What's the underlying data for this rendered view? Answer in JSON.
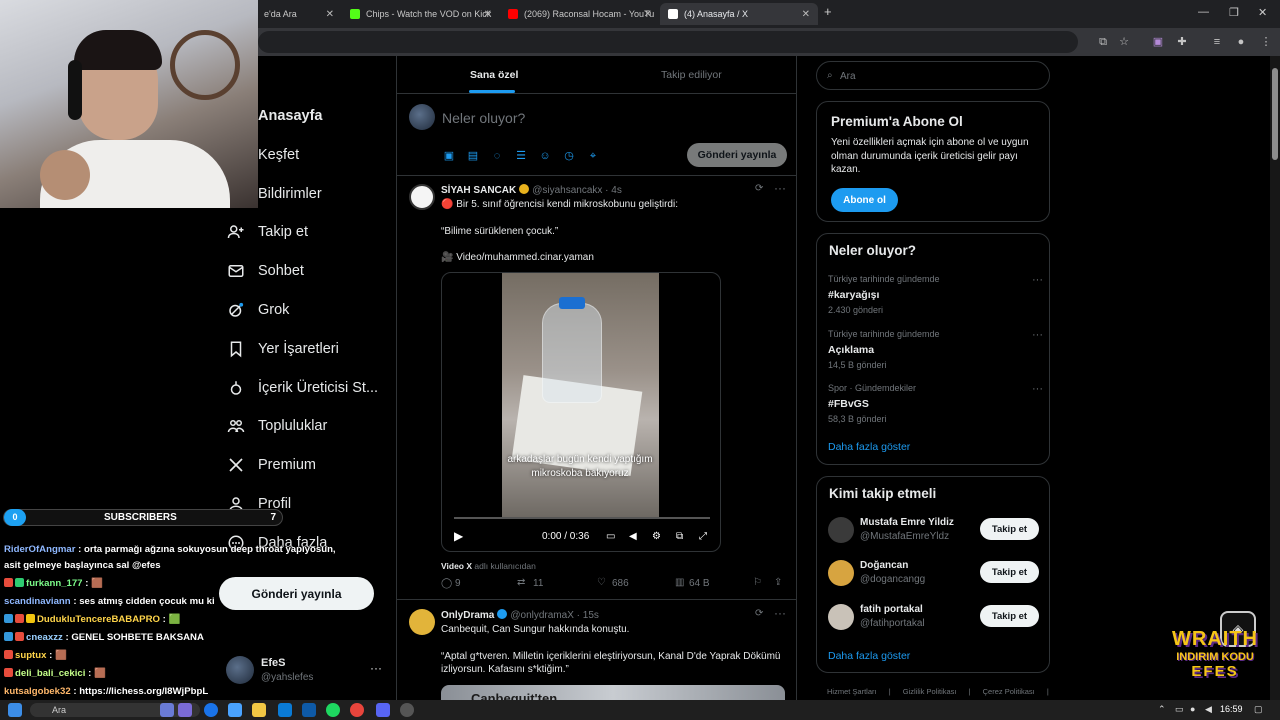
{
  "browser": {
    "tabs": [
      {
        "title": "e'da Ara",
        "color": "#4285f4"
      },
      {
        "title": "Chips - Watch the VOD on Kick",
        "color": "#53fc18"
      },
      {
        "title": "(2069) Raconsal Hocam - YouTu",
        "color": "#ff0000"
      },
      {
        "title": "(4) Anasayfa / X",
        "color": "#ffffff",
        "active": true
      }
    ],
    "new_tab": "+"
  },
  "nav": {
    "items": [
      {
        "label": "Anasayfa",
        "icon": "home-icon",
        "bold": true
      },
      {
        "label": "Keşfet",
        "icon": "explore-icon"
      },
      {
        "label": "Bildirimler",
        "icon": "bell-icon"
      },
      {
        "label": "Takip et",
        "icon": "follow-icon"
      },
      {
        "label": "Sohbet",
        "icon": "mail-icon"
      },
      {
        "label": "Grok",
        "icon": "grok-icon"
      },
      {
        "label": "Yer İşaretleri",
        "icon": "bookmark-icon"
      },
      {
        "label": "İçerik Üreticisi St...",
        "icon": "creator-studio-icon"
      },
      {
        "label": "Topluluklar",
        "icon": "communities-icon"
      },
      {
        "label": "Premium",
        "icon": "x-logo-icon"
      },
      {
        "label": "Profil",
        "icon": "profile-icon"
      },
      {
        "label": "Daha fazla",
        "icon": "more-circle-icon"
      }
    ],
    "post_button": "Gönderi yayınla",
    "account": {
      "name": "EfeS",
      "handle": "@yahslefes",
      "more": "···"
    }
  },
  "stream": {
    "subs_left": "0",
    "subs_label": "SUBSCRIBERS",
    "subs_right": "7",
    "chat": [
      {
        "user": "RiderOfAngmar",
        "msg": ": orta parmağı ağzına sokuyosun deep throat yapıyosun,"
      },
      {
        "user": "",
        "msg": "asit gelmeye başlayınca sal @efes"
      },
      {
        "user": "furkann_177",
        "msg": ": 🟫"
      },
      {
        "user": "scandinaviann",
        "msg": ": ses atmış cidden çocuk mu ki"
      },
      {
        "user": "DudukluTencereBABAPRO",
        "msg": ": 🟩"
      },
      {
        "user": "cneaxzz",
        "msg": ": GENEL SOHBETE BAKSANA"
      },
      {
        "user": "suptux",
        "msg": ": 🟫"
      },
      {
        "user": "deli_bali_cekici",
        "msg": ": 🟫"
      },
      {
        "user": "kutsalgobek32",
        "msg": ": https://lichess.org/I8WjPbpL"
      }
    ],
    "sponsor": {
      "line1": "WRAITH",
      "line2": "INDIRIM KODU",
      "line3": "EFES"
    }
  },
  "main": {
    "tabs": [
      "Sana özel",
      "Takip ediliyor"
    ],
    "composer": {
      "placeholder": "Neler oluyor?",
      "post": "Gönderi yayınla"
    },
    "tweets": [
      {
        "name": "SİYAH SANCAK",
        "handle": "@siyahsancakx",
        "time": "· 4s",
        "lines": [
          "🔴 Bir 5. sınıf öğrencisi kendi mikroskobunu geliştirdi:",
          "“Bilime sürüklenen çocuk.”",
          "🎥 Video/muhammed.cinar.yaman"
        ],
        "video": {
          "caption": "arkadaşlar bugün kendi yaptığım mikroskoba bakıyoruz",
          "time": "0:00 / 0:36",
          "progress": 0
        },
        "source_label": "Video X",
        "source_rest": "adlı kullanıcıdan",
        "stats": {
          "replies": "9",
          "reposts": "11",
          "likes": "686",
          "views": "64 B"
        }
      },
      {
        "name": "OnlyDrama",
        "handle": "@onlydramaX",
        "time": "· 15s",
        "lines": [
          "Canbequit, Can Sungur hakkında konuştu.",
          "“Aptal g*tveren. Milletin içeriklerini eleştiriyorsun, Kanal D'de Yaprak Dökümü izliyorsun. Kafasını s*ktiğim.”"
        ],
        "preview_text": "Canbequit'ten"
      }
    ]
  },
  "right": {
    "search_placeholder": "Ara",
    "premium": {
      "title": "Premium'a Abone Ol",
      "text": "Yeni özellikleri açmak için abone ol ve uygun olman durumunda içerik üreticisi gelir payı kazan.",
      "button": "Abone ol"
    },
    "trends": {
      "title": "Neler oluyor?",
      "items": [
        {
          "context": "Türkiye tarihinde gündemde",
          "tag": "#karyağışı",
          "count": "2.430 gönderi"
        },
        {
          "context": "Türkiye tarihinde gündemde",
          "tag": "Açıklama",
          "count": "14,5 B gönderi"
        },
        {
          "context": "Spor · Gündemdekiler",
          "tag": "#FBvGS",
          "count": "58,3 B gönderi"
        }
      ],
      "show_more": "Daha fazla göster"
    },
    "who_to_follow": {
      "title": "Kimi takip etmeli",
      "items": [
        {
          "name": "Mustafa Emre Yildiz",
          "handle": "@MustafaEmreYldz",
          "button": "Takip et"
        },
        {
          "name": "Doğancan",
          "handle": "@dogancangg",
          "button": "Takip et"
        },
        {
          "name": "fatih portakal",
          "handle": "@fatihportakal",
          "button": "Takip et"
        }
      ],
      "show_more": "Daha fazla göster"
    },
    "footer": [
      "Hizmet Şartları",
      "|",
      "Gizlilik Politikası",
      "|",
      "Çerez Politikası",
      "|"
    ]
  },
  "taskbar": {
    "search": "Ara",
    "time": "16:59"
  },
  "colors": {
    "accent": "#1d9bf0",
    "background": "#000000",
    "border": "#2f3336"
  }
}
